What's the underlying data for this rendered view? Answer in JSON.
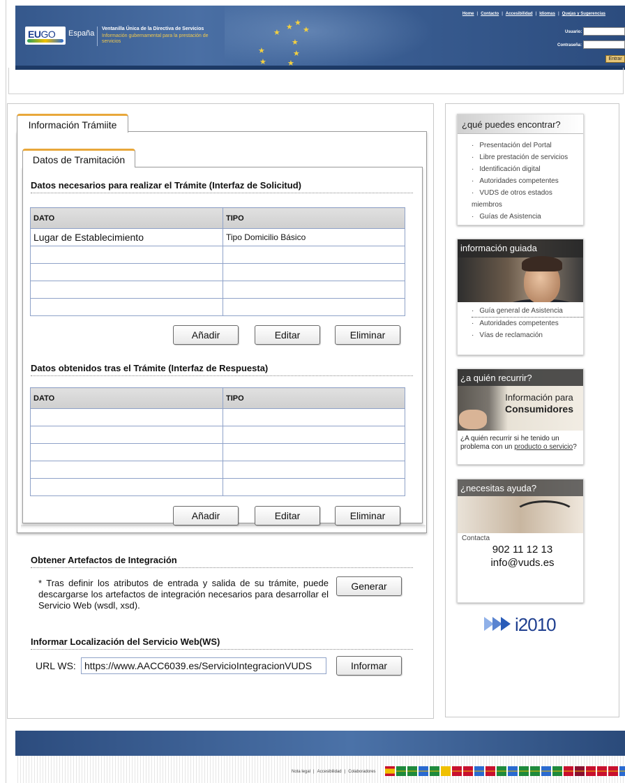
{
  "header": {
    "logo_text_eu": "EU",
    "logo_text_go": "GO",
    "country": "España",
    "title": "Ventanilla Única de la Directiva de Servicios",
    "subtitle": "Información gubernamental para la prestación de servicios",
    "links": [
      "Home",
      "Contacto",
      "Accesibilidad",
      "Idiomas",
      "Quejas y Sugerencias"
    ],
    "user_label": "Usuario:",
    "password_label": "Contraseña:",
    "user_value": "",
    "password_value": "",
    "enter_label": "Entrar"
  },
  "tabs": {
    "outer": "Información Trámiite",
    "inner": "Datos de Tramitación"
  },
  "solicitud": {
    "title": "Datos necesarios para realizar el Trámite (Interfaz de Solicitud)",
    "columns": [
      "DATO",
      "TIPO"
    ],
    "rows": [
      [
        "Lugar de Establecimiento",
        "Tipo Domicilio Básico"
      ],
      [
        "",
        ""
      ],
      [
        "",
        ""
      ],
      [
        "",
        ""
      ],
      [
        "",
        ""
      ]
    ],
    "buttons": {
      "add": "Añadir",
      "edit": "Editar",
      "delete": "Eliminar"
    }
  },
  "respuesta": {
    "title": "Datos obtenidos tras el Trámite (Interfaz de Respuesta)",
    "columns": [
      "DATO",
      "TIPO"
    ],
    "rows": [
      [
        "",
        ""
      ],
      [
        "",
        ""
      ],
      [
        "",
        ""
      ],
      [
        "",
        ""
      ],
      [
        "",
        ""
      ]
    ],
    "buttons": {
      "add": "Añadir",
      "edit": "Editar",
      "delete": "Eliminar"
    }
  },
  "artefactos": {
    "title": "Obtener Artefactos de Integración",
    "text": "* Tras definir los atributos de entrada y salida de su trámite, puede descargarse los artefactos de integración necesarios para desarrollar el Servicio Web (wsdl, xsd).",
    "button": "Generar"
  },
  "localizacion": {
    "title": "Informar Localización del Servicio Web(WS)",
    "label": "URL WS:",
    "url": "https://www.AACC6039.es/ServicioIntegracionVUDS",
    "button": "Informar"
  },
  "sidebar": {
    "encontrar": {
      "title": "¿qué puedes encontrar?",
      "items": [
        "Presentación del Portal",
        "Libre prestación de servicios",
        "Identificación digital",
        "Autoridades competentes",
        "VUDS de otros estados miembros",
        "Guías de Asistencia"
      ]
    },
    "guiada": {
      "title": "información guiada",
      "items": [
        "Guía general de Asistencia",
        "Autoridades competentes",
        "Vías de reclamación"
      ]
    },
    "recurrir": {
      "title": "¿a quién recurrir?",
      "banner_line1": "Información para",
      "banner_line2": "Consumidores",
      "question_prefix": "¿A quién recurrir si he tenido un problema con un ",
      "question_link": "producto o servicio",
      "question_suffix": "?"
    },
    "ayuda": {
      "title": "¿necesitas ayuda?",
      "contact_label": "Contacta",
      "phone": "902 11 12 13",
      "email": "info@vuds.es"
    },
    "i2010": "i2010"
  },
  "footer": {
    "links": [
      "Nota legal",
      "Accesibilidad",
      "Colaboradores"
    ],
    "flag_colors": [
      "#c8102e",
      "#1e8a3c",
      "#1e8a3c",
      "#2a6ad0",
      "#1e8a3c",
      "#f0c000",
      "#c8102e",
      "#c8102e",
      "#2a6ad0",
      "#c8102e",
      "#1e8a3c",
      "#2a6ad0",
      "#1e8a3c",
      "#1e8a3c",
      "#2a6ad0",
      "#1e8a3c",
      "#c8102e",
      "#8a1030",
      "#c8102e",
      "#c8102e",
      "#c8102e",
      "#2a6ad0"
    ]
  }
}
